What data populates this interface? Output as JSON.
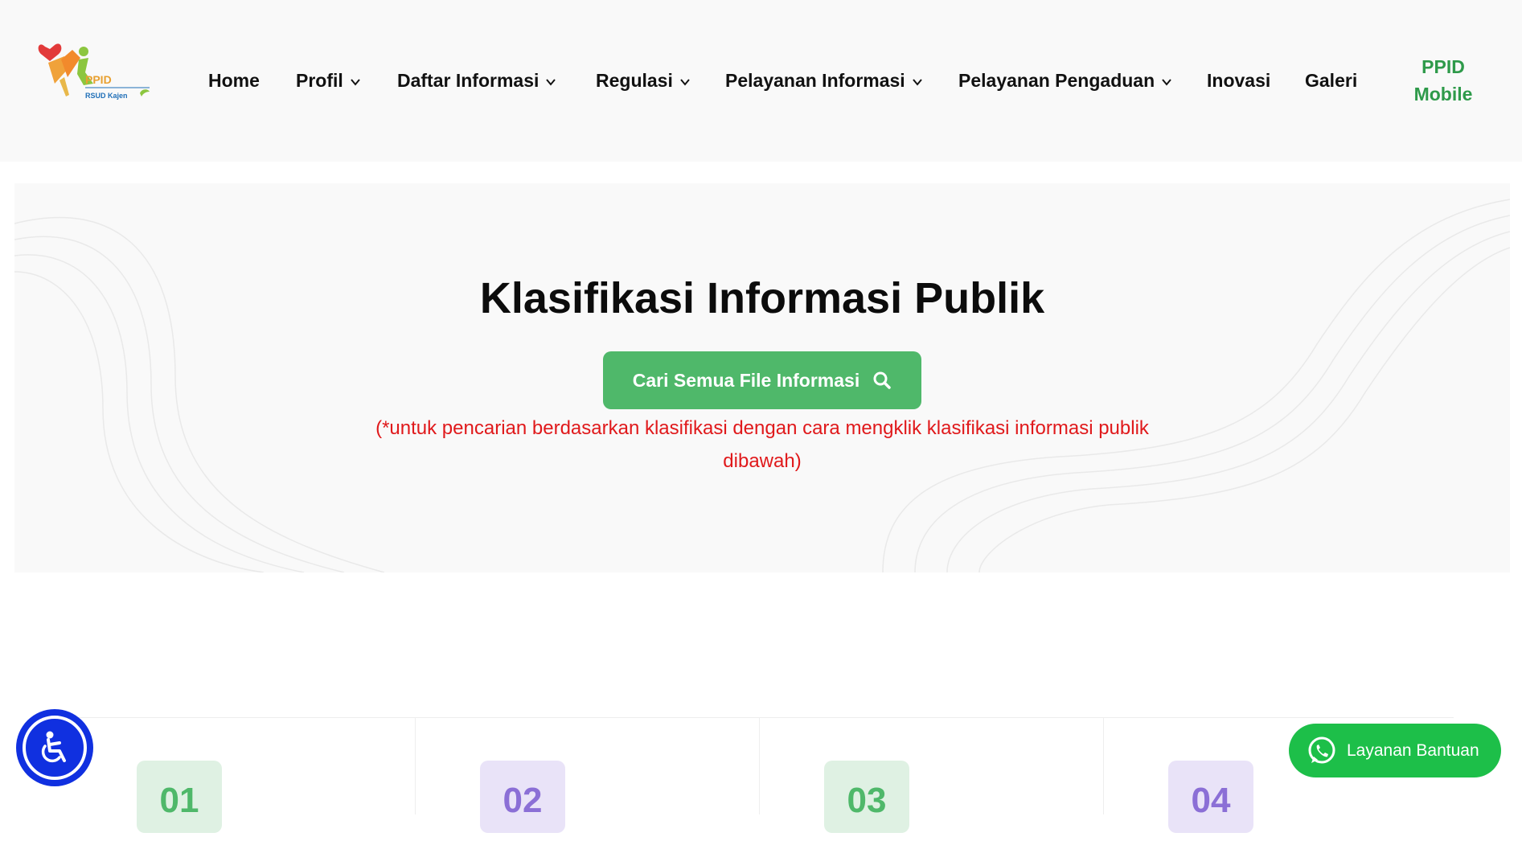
{
  "header": {
    "logo": {
      "text": "PPID",
      "subtext": "RSUD Kajen",
      "icon": "ppid-logo-figure"
    },
    "nav": [
      {
        "label": "Home",
        "has_dropdown": false
      },
      {
        "label": "Profil",
        "has_dropdown": true
      },
      {
        "label": "Daftar Informasi",
        "has_dropdown": true
      },
      {
        "label": "Regulasi",
        "has_dropdown": true
      },
      {
        "label": "Pelayanan Informasi",
        "has_dropdown": true
      },
      {
        "label": "Pelayanan Pengaduan",
        "has_dropdown": true
      },
      {
        "label": "Inovasi",
        "has_dropdown": false
      },
      {
        "label": "Galeri",
        "has_dropdown": false
      }
    ],
    "mobile_link": {
      "line1": "PPID",
      "line2": "Mobile"
    }
  },
  "hero": {
    "title": "Klasifikasi Informasi Publik",
    "search_button": "Cari Semua File Informasi",
    "search_icon": "search-icon",
    "hint": "(*untuk pencarian berdasarkan klasifikasi dengan cara mengklik klasifikasi informasi publik dibawah)"
  },
  "cards": [
    {
      "number": "01",
      "color": "#4fb86a",
      "bg": "#dff1e3"
    },
    {
      "number": "02",
      "color": "#8b6fd6",
      "bg": "#e9e3f8"
    },
    {
      "number": "03",
      "color": "#4fb86a",
      "bg": "#dff1e3"
    },
    {
      "number": "04",
      "color": "#8b6fd6",
      "bg": "#e9e3f8"
    }
  ],
  "widgets": {
    "accessibility_icon": "accessibility-icon",
    "whatsapp_label": "Layanan Bantuan",
    "whatsapp_icon": "whatsapp-icon"
  },
  "colors": {
    "accent_green": "#4fb86a",
    "hint_red": "#e0191b",
    "accessibility_blue": "#1030e0",
    "whatsapp_green": "#1dbf49"
  }
}
